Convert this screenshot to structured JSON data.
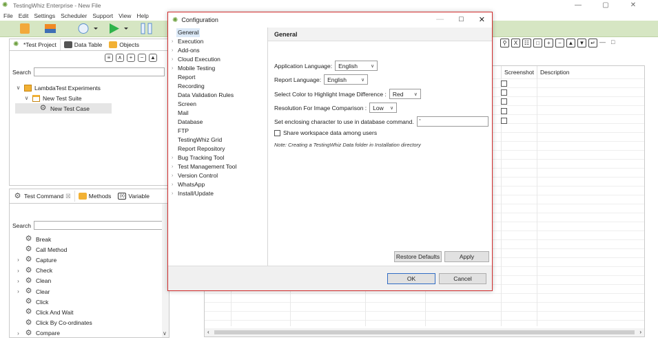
{
  "app": {
    "title": "TestingWhiz Enterprise - New File",
    "icon": "testingwhiz-logo-icon",
    "window_controls": [
      "—",
      "▢",
      "✕"
    ]
  },
  "menu": [
    "File",
    "Edit",
    "Settings",
    "Scheduler",
    "Support",
    "View",
    "Help"
  ],
  "project_tabs": {
    "test_project": "*Test Project",
    "data_table": "Data Table",
    "objects": "Objects"
  },
  "project_panel": {
    "search_label": "Search",
    "tree": [
      {
        "label": "LambdaTest Experiments",
        "level": 0,
        "icon": "project-icon"
      },
      {
        "label": "New Test Suite",
        "level": 1,
        "icon": "folder-icon"
      },
      {
        "label": "New Test Case",
        "level": 2,
        "icon": "gear-icon"
      }
    ]
  },
  "command_tabs": {
    "test_command": "Test Command",
    "close_mark": "☒",
    "methods": "Methods",
    "variable": "Variable"
  },
  "command_panel": {
    "search_label": "Search",
    "items": [
      "Break",
      "Call Method",
      "Capture",
      "Check",
      "Clean",
      "Clear",
      "Click",
      "Click And Wait",
      "Click By Co-ordinates",
      "Compare"
    ]
  },
  "grid": {
    "columns": [
      "Screenshot",
      "Description"
    ]
  },
  "dialog": {
    "title": "Configuration",
    "nav": [
      {
        "label": "General",
        "expandable": false,
        "selected": true
      },
      {
        "label": "Execution",
        "expandable": true
      },
      {
        "label": "Add-ons",
        "expandable": true
      },
      {
        "label": "Cloud Execution",
        "expandable": true
      },
      {
        "label": "Mobile Testing",
        "expandable": true
      },
      {
        "label": "Report",
        "expandable": false
      },
      {
        "label": "Recording",
        "expandable": false
      },
      {
        "label": "Data Validation Rules",
        "expandable": false
      },
      {
        "label": "Screen",
        "expandable": false
      },
      {
        "label": "Mail",
        "expandable": false
      },
      {
        "label": "Database",
        "expandable": false
      },
      {
        "label": "FTP",
        "expandable": false
      },
      {
        "label": "TestingWhiz Grid",
        "expandable": false
      },
      {
        "label": "Report Repository",
        "expandable": false
      },
      {
        "label": "Bug Tracking Tool",
        "expandable": true
      },
      {
        "label": "Test Management Tool",
        "expandable": true
      },
      {
        "label": "Version Control",
        "expandable": true
      },
      {
        "label": "WhatsApp",
        "expandable": true
      },
      {
        "label": "Install/Update",
        "expandable": true
      }
    ],
    "heading": "General",
    "fields": {
      "app_language_label": "Application Language:",
      "app_language_value": "English",
      "report_language_label": "Report Language:",
      "report_language_value": "English",
      "highlight_color_label": "Select Color to Highlight Image Difference :",
      "highlight_color_value": "Red",
      "resolution_label": "Resolution For Image Comparison :",
      "resolution_value": "Low",
      "enclosing_char_label": "Set enclosing character to use in database command.",
      "enclosing_char_value": "'",
      "share_workspace_label": "Share workspace data among users",
      "share_workspace_checked": false
    },
    "note": "Note: Creating a TestingWhiz Data folder in Installation directory",
    "restore_defaults": "Restore Defaults",
    "apply": "Apply",
    "ok": "OK",
    "cancel": "Cancel"
  },
  "colors": {
    "toolbar_bg": "#d6e6c3",
    "dialog_border": "#d22c2c",
    "primary_button_border": "#2f6bc4",
    "selection_bg": "#dbe9f7"
  }
}
